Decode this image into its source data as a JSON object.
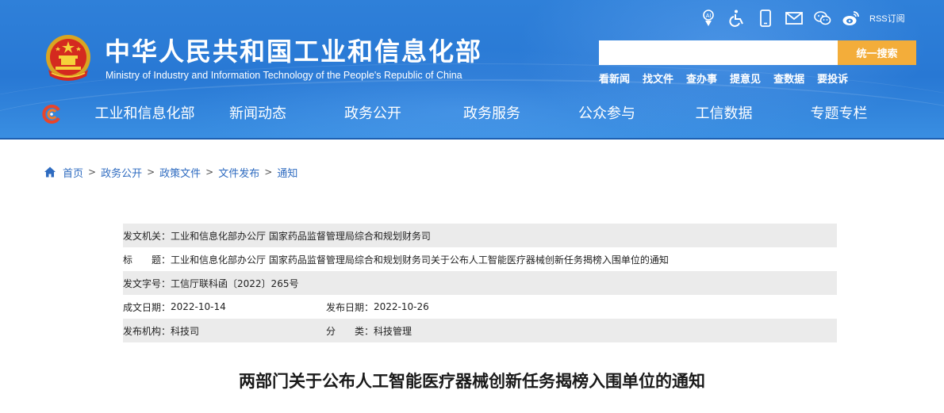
{
  "header": {
    "title": "中华人民共和国工业和信息化部",
    "subtitle": "Ministry of Industry and Information Technology of the People's Republic of China",
    "rss_label": "RSS订阅",
    "top_icons": [
      "accessibility-ai-icon",
      "wheelchair-icon",
      "mobile-icon",
      "mail-icon",
      "wechat-icon",
      "weibo-icon"
    ],
    "search": {
      "placeholder": "",
      "button_label": "统一搜索"
    },
    "quick_links": [
      "看新闻",
      "找文件",
      "查办事",
      "提意见",
      "查数据",
      "要投诉"
    ],
    "nav": [
      "工业和信息化部",
      "新闻动态",
      "政务公开",
      "政务服务",
      "公众参与",
      "工信数据",
      "专题专栏"
    ]
  },
  "breadcrumb": [
    "首页",
    "政务公开",
    "政策文件",
    "文件发布",
    "通知"
  ],
  "meta": {
    "issuer_label": "发文机关：",
    "issuer": "工业和信息化部办公厅 国家药品监督管理局综合和规划财务司",
    "title_label": "标　　题：",
    "title": "工业和信息化部办公厅 国家药品监督管理局综合和规划财务司关于公布人工智能医疗器械创新任务揭榜入围单位的通知",
    "doc_no_label": "发文字号：",
    "doc_no": "工信厅联科函〔2022〕265号",
    "created_label": "成文日期：",
    "created": "2022-10-14",
    "published_label": "发布日期：",
    "published": "2022-10-26",
    "org_label": "发布机构：",
    "org": "科技司",
    "category_label": "分　　类：",
    "category": "科技管理"
  },
  "article": {
    "title": "两部门关于公布人工智能医疗器械创新任务揭榜入围单位的通知"
  },
  "colors": {
    "header_blue": "#2f80d9",
    "search_button": "#f3ad3a",
    "link_blue": "#2e6bc0",
    "row_shade": "#ebebeb"
  }
}
